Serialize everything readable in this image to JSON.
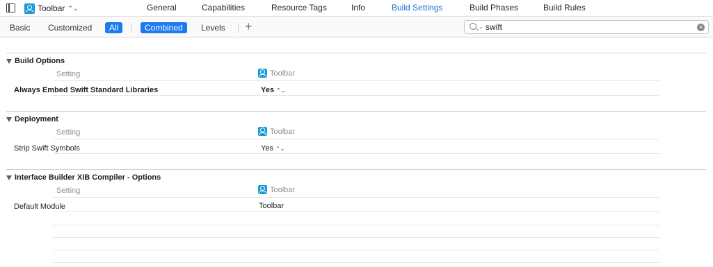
{
  "header": {
    "target": {
      "label": "Toolbar",
      "icon": "app-target-icon"
    },
    "tabs": [
      {
        "label": "General",
        "active": false
      },
      {
        "label": "Capabilities",
        "active": false
      },
      {
        "label": "Resource Tags",
        "active": false
      },
      {
        "label": "Info",
        "active": false
      },
      {
        "label": "Build Settings",
        "active": true
      },
      {
        "label": "Build Phases",
        "active": false
      },
      {
        "label": "Build Rules",
        "active": false
      }
    ]
  },
  "filter_bar": {
    "basic": "Basic",
    "customized": "Customized",
    "all": "All",
    "combined": "Combined",
    "levels": "Levels",
    "add": "+",
    "search_value": "swift"
  },
  "sections": [
    {
      "title": "Build Options",
      "header": {
        "setting": "Setting",
        "target": "Toolbar"
      },
      "rows": [
        {
          "name": "Always Embed Swift Standard Libraries",
          "value": "Yes",
          "bold": true,
          "stepper": true
        }
      ]
    },
    {
      "title": "Deployment",
      "header": {
        "setting": "Setting",
        "target": "Toolbar"
      },
      "rows": [
        {
          "name": "Strip Swift Symbols",
          "value": "Yes",
          "bold": false,
          "stepper": true
        }
      ]
    },
    {
      "title": "Interface Builder XIB Compiler - Options",
      "header": {
        "setting": "Setting",
        "target": "Toolbar"
      },
      "rows": [
        {
          "name": "Default Module",
          "value": "Toolbar",
          "bold": false,
          "stepper": false
        }
      ]
    }
  ],
  "colors": {
    "accent": "#1c7bf0",
    "active_tab": "#1a73d9",
    "target_icon": "#1a9ad6"
  }
}
